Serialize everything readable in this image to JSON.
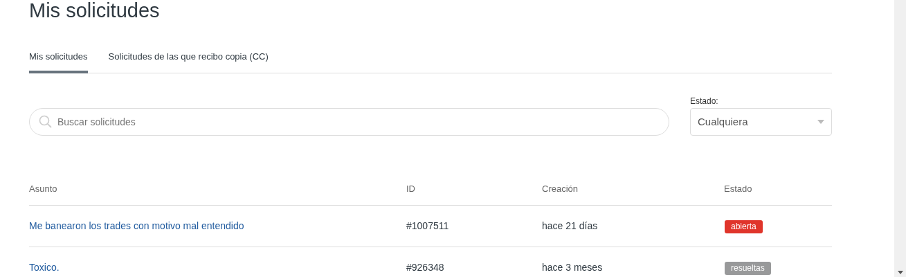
{
  "title": "Mis solicitudes",
  "tabs": [
    {
      "label": "Mis solicitudes",
      "selected": true
    },
    {
      "label": "Solicitudes de las que recibo copia (CC)",
      "selected": false
    }
  ],
  "search": {
    "placeholder": "Buscar solicitudes"
  },
  "status_filter": {
    "label": "Estado:",
    "value": "Cualquiera"
  },
  "table": {
    "columns": [
      "Asunto",
      "ID",
      "Creación",
      "Estado"
    ],
    "rows": [
      {
        "subject": "Me banearon los trades con motivo mal entendido",
        "id": "#1007511",
        "created": "hace 21 días",
        "status": "abierta",
        "color": "#e0352b"
      },
      {
        "subject": "Toxico.",
        "id": "#926348",
        "created": "hace 3 meses",
        "status": "resueltas",
        "color": "#98999a"
      }
    ]
  }
}
